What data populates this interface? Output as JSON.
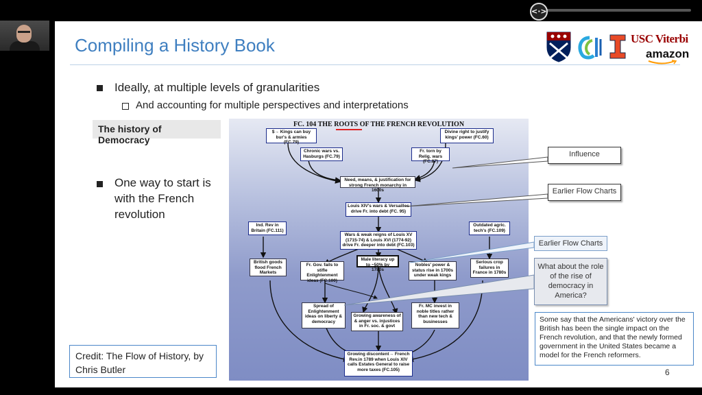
{
  "player": {
    "scrub_glyph": "<·>"
  },
  "slide": {
    "title": "Compiling a History Book",
    "bullet1": "Ideally, at multiple levels of granularities",
    "sub_bullet1": "And accounting for multiple perspectives and interpretations",
    "history_label": "The history of Democracy",
    "bullet2": "One way to start is with the French revolution",
    "credit": "Credit: The Flow of History, by Chris Butler",
    "number": "6",
    "logos": {
      "usc": "USC Viterbi",
      "amazon": "amazon"
    }
  },
  "flowchart": {
    "title": "FC. 104 THE ROOTS OF THE FRENCH REVOLUTION",
    "boxes": {
      "kings_buy": "$→ Kings can buy bur's & armies (FC.79)",
      "divine_right": "Divine right to justify kings' power (FC.60)",
      "chronic_wars": "Chronic wars vs. Hasburgs (FC.79)",
      "torn_relig": "Fr. torn by Relig. wars (FC.87)",
      "need_means": "Need, means, & justification for strong French monarchy in 1600s",
      "louis_xiv": "Louis XIV's wars & Versailles drive Fr. into debt (FC. 95)",
      "ind_rev": "Ind. Rev in Britain (FC.111)",
      "outdated": "Outdated agric. tech's (FC.109)",
      "wars_weak": "Wars & weak reigns of Louis XV (1715-74) & Louis XVI (1774-92) drive Fr. deeper into debt (FC.103)",
      "british_goods": "British goods flood French Markets",
      "fails_stifle": "Fr. Gov. fails to stifle Enlightenment ideas (FC.100)",
      "male_literacy": "Male literacy up to ~50% by 1780s",
      "nobles_power": "Nobles' power & status rise in 1700s under weak kings",
      "crop_failures": "Serious crop failures in France in 1780s",
      "spread_enlight": "Spread of Enlightenment ideas on liberty & democracy",
      "growing_aware": "Growing awareness of & anger vs. injustices in Fr. soc. & govt",
      "mc_invest": "Fr. MC invest in noble titles rather than new tech & businesses",
      "discontent": "Growing discontent→ French Rev.in 1789 when Louis XIV calls Estates General to raise more taxes (FC.105)"
    }
  },
  "callouts": {
    "influence": "Influence",
    "earlier1": "Earlier Flow Charts",
    "earlier2": "Earlier Flow Charts",
    "america": "What about the role of the rise of democracy in America?"
  },
  "note": "Some say that the Americans' victory over the British has been the single impact on the French revolution, and that the newly formed government  in the United States became a model for the French reformers."
}
